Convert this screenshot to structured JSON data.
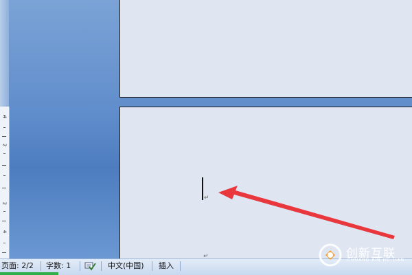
{
  "status": {
    "page_label": "页面: 2/2",
    "word_count_label": "字数: 1",
    "language_label": "中文(中国)",
    "mode_label": "插入"
  },
  "ruler": {
    "numbers": [
      "4",
      "2",
      "2",
      "4"
    ]
  },
  "logo": {
    "name": "创新互联",
    "subtitle": "CHUANG XIN HU LIAN"
  },
  "icons": {
    "spell_check": "spell-check-icon",
    "logo_mark": "logo-mark-icon"
  },
  "colors": {
    "arrow": "#e8383d",
    "accent_green": "#2fae4a",
    "page": "#dfe6f1",
    "workspace": "#5f8ccb"
  }
}
